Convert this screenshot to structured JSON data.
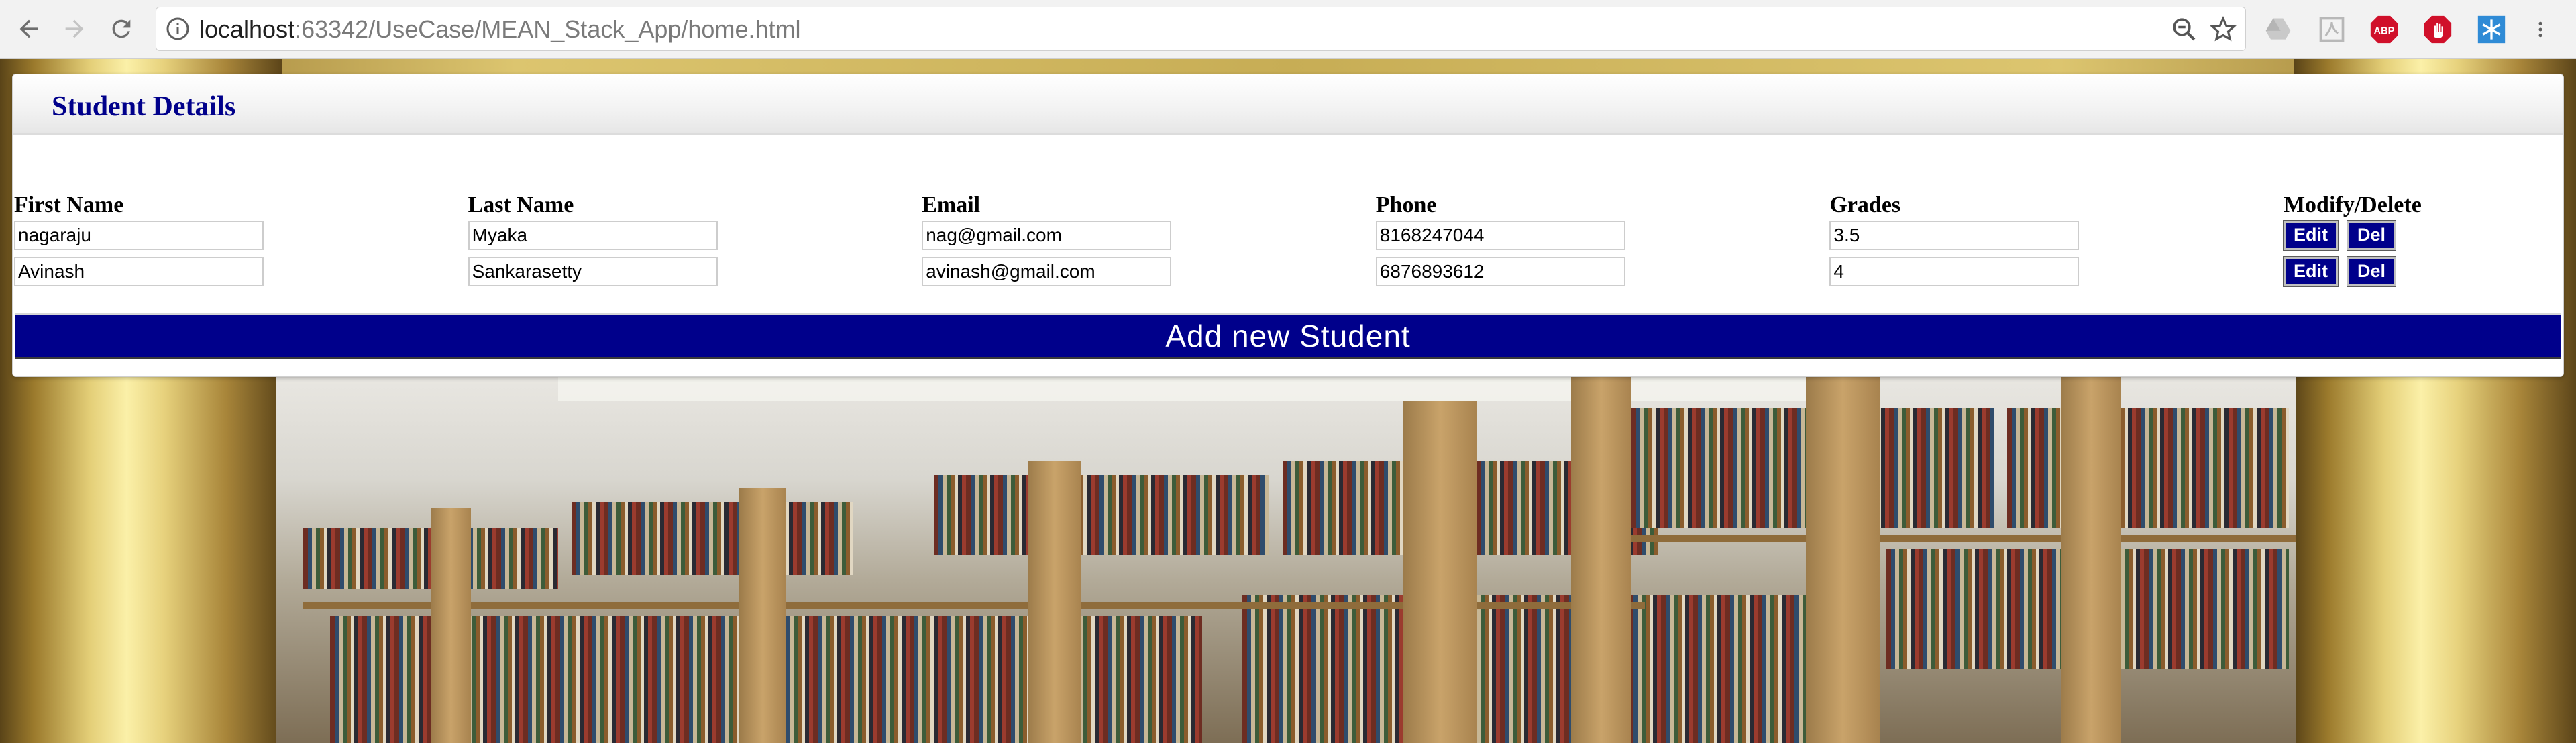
{
  "browser": {
    "url_host": "localhost",
    "url_path": ":63342/UseCase/MEAN_Stack_App/home.html",
    "extensions": [
      "drive-icon",
      "pdf-icon",
      "adblock-icon",
      "hand-stop-icon",
      "snowflake-icon"
    ],
    "abp_label": "ABP"
  },
  "panel": {
    "title": "Student Details",
    "columns": [
      "First Name",
      "Last Name",
      "Email",
      "Phone",
      "Grades",
      "Modify/Delete"
    ],
    "rows": [
      {
        "first": "nagaraju",
        "last": "Myaka",
        "email": "nag@gmail.com",
        "phone": "8168247044",
        "grades": "3.5"
      },
      {
        "first": "Avinash",
        "last": "Sankarasetty",
        "email": "avinash@gmail.com",
        "phone": "6876893612",
        "grades": "4"
      }
    ],
    "edit_label": "Edit",
    "del_label": "Del",
    "add_label": "Add new Student"
  },
  "colors": {
    "accent": "#00008b",
    "title": "#00008b"
  }
}
